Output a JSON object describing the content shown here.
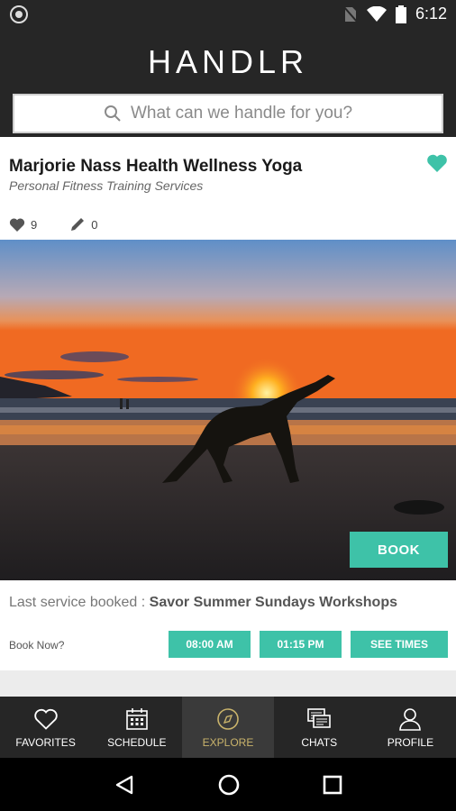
{
  "status_bar": {
    "time": "6:12"
  },
  "app": {
    "title": "HANDLR"
  },
  "search": {
    "placeholder": "What can we handle for you?"
  },
  "listing": {
    "name": "Marjorie Nass Health Wellness Yoga",
    "category": "Personal Fitness Training Services",
    "likes": "9",
    "reviews": "0",
    "book_label": "BOOK",
    "last_booked_label": "Last service booked :",
    "last_booked_service": "Savor Summer Sundays Workshops",
    "book_now_label": "Book Now?",
    "times": [
      "08:00 AM",
      "01:15 PM"
    ],
    "see_times_label": "SEE TIMES"
  },
  "tabs": [
    {
      "label": "FAVORITES",
      "icon": "heart-icon"
    },
    {
      "label": "SCHEDULE",
      "icon": "calendar-icon"
    },
    {
      "label": "EXPLORE",
      "icon": "compass-icon",
      "active": true
    },
    {
      "label": "CHATS",
      "icon": "chat-icon"
    },
    {
      "label": "PROFILE",
      "icon": "user-icon"
    }
  ],
  "colors": {
    "accent": "#3ec2a8",
    "active_tab": "#c9b36b",
    "bar": "#262626"
  }
}
